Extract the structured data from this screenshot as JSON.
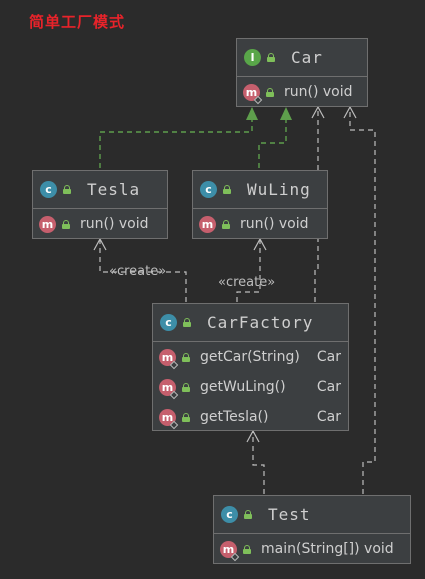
{
  "title": "简单工厂模式",
  "colors": {
    "background": "#2b2b2b",
    "node_fill": "#3c3f41",
    "realization_edge": "#5e9e4c",
    "dependency_edge": "#bdbdbd",
    "title": "#e8232a"
  },
  "nodes": {
    "car": {
      "kind": "interface",
      "icon": "interface-icon",
      "name": "Car",
      "members": [
        {
          "signature": "run() void",
          "return_type": ""
        }
      ]
    },
    "tesla": {
      "kind": "class",
      "icon": "class-icon",
      "name": "Tesla",
      "members": [
        {
          "signature": "run() void",
          "return_type": ""
        }
      ]
    },
    "wuling": {
      "kind": "class",
      "icon": "class-icon",
      "name": "WuLing",
      "members": [
        {
          "signature": "run() void",
          "return_type": ""
        }
      ]
    },
    "carfactory": {
      "kind": "class",
      "icon": "class-icon",
      "name": "CarFactory",
      "members": [
        {
          "signature": "getCar(String)",
          "return_type": "Car"
        },
        {
          "signature": "getWuLing()",
          "return_type": "Car"
        },
        {
          "signature": "getTesla()",
          "return_type": "Car"
        }
      ]
    },
    "test": {
      "kind": "class",
      "icon": "class-icon",
      "name": "Test",
      "members": [
        {
          "signature": "main(String[]) void",
          "return_type": ""
        }
      ]
    }
  },
  "edges": [
    {
      "from": "Tesla",
      "to": "Car",
      "type": "realization"
    },
    {
      "from": "WuLing",
      "to": "Car",
      "type": "realization"
    },
    {
      "from": "CarFactory",
      "to": "Tesla",
      "type": "dependency",
      "label": "«create»"
    },
    {
      "from": "CarFactory",
      "to": "WuLing",
      "type": "dependency",
      "label": "«create»"
    },
    {
      "from": "CarFactory",
      "to": "Car",
      "type": "dependency"
    },
    {
      "from": "Test",
      "to": "CarFactory",
      "type": "dependency"
    },
    {
      "from": "Test",
      "to": "Car",
      "type": "dependency"
    }
  ]
}
